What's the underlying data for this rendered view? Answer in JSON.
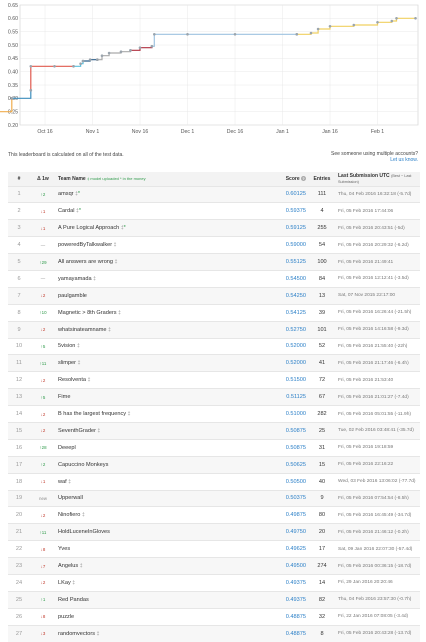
{
  "chart_data": {
    "type": "line",
    "x_tick_labels": [
      "Oct 16",
      "Nov 1",
      "Nov 16",
      "Dec 1",
      "Dec 16",
      "Jan 1",
      "Jan 16",
      "Feb 1"
    ],
    "y_tick_labels": [
      "0.20",
      "0.25",
      "0.30",
      "0.35",
      "0.40",
      "0.45",
      "0.50",
      "0.55",
      "0.60",
      "0.65"
    ],
    "ylim": [
      0.2,
      0.65
    ],
    "grid": true,
    "series": [
      {
        "color": "#f0ad4e",
        "points": [
          [
            -1.0,
            0.25
          ],
          [
            -0.7,
            0.3
          ]
        ]
      },
      {
        "color": "#3c8dbc",
        "points": [
          [
            -0.7,
            0.3
          ],
          [
            -0.3,
            0.33
          ]
        ]
      },
      {
        "color": "#e05a4f",
        "points": [
          [
            -0.3,
            0.33
          ],
          [
            -0.3,
            0.42
          ],
          [
            0.2,
            0.42
          ],
          [
            0.6,
            0.42
          ]
        ]
      },
      {
        "color": "#5bc0de",
        "points": [
          [
            0.6,
            0.42
          ],
          [
            0.75,
            0.43
          ],
          [
            0.8,
            0.44
          ]
        ]
      },
      {
        "color": "#2c5f8a",
        "points": [
          [
            0.8,
            0.44
          ],
          [
            0.95,
            0.445
          ],
          [
            1.1,
            0.445
          ]
        ]
      },
      {
        "color": "#aaaaaa",
        "points": [
          [
            1.1,
            0.445
          ],
          [
            1.2,
            0.46
          ],
          [
            1.35,
            0.47
          ],
          [
            1.6,
            0.475
          ],
          [
            1.8,
            0.48
          ]
        ]
      },
      {
        "color": "#b03040",
        "points": [
          [
            1.8,
            0.48
          ],
          [
            2.0,
            0.49
          ],
          [
            2.25,
            0.495
          ]
        ]
      },
      {
        "color": "#9fc3e0",
        "points": [
          [
            2.25,
            0.495
          ],
          [
            2.3,
            0.54
          ],
          [
            3.0,
            0.54
          ],
          [
            4.0,
            0.54
          ],
          [
            5.3,
            0.54
          ]
        ]
      },
      {
        "color": "#f0d060",
        "points": [
          [
            5.3,
            0.54
          ],
          [
            5.6,
            0.545
          ],
          [
            5.75,
            0.56
          ],
          [
            6.0,
            0.57
          ],
          [
            6.5,
            0.575
          ],
          [
            7.0,
            0.585
          ],
          [
            7.3,
            0.59
          ],
          [
            7.4,
            0.6
          ],
          [
            7.8,
            0.6
          ]
        ]
      }
    ]
  },
  "notes": {
    "left": "This leaderboard is calculated on all of the test data.",
    "right_line1": "See someone using multiple accounts?",
    "right_line2": "Let us know."
  },
  "table": {
    "headers": {
      "rank": "#",
      "delta": "Δ 1w",
      "team": "Team Name",
      "team_legend": "‡ model uploaded * in the money",
      "score": "Score",
      "entries": "Entries",
      "last": "Last Submission UTC",
      "last_sub": "(Best − Last Submission)"
    },
    "rows": [
      {
        "rank": "1",
        "delta": "↑2",
        "dir": "up",
        "team": "amsqr",
        "marks": "‡",
        "star": "*",
        "score": "0.60125",
        "entries": "111",
        "last": "Thu, 04 Feb 2016 16:32:18 (-5.7d)"
      },
      {
        "rank": "2",
        "delta": "↓1",
        "dir": "down",
        "team": "Cardal",
        "marks": "‡",
        "star": "*",
        "score": "0.59375",
        "entries": "4",
        "last": "Fri, 05 Feb 2016 17:44:06"
      },
      {
        "rank": "3",
        "delta": "↓1",
        "dir": "down",
        "team": "A Pure Logical Approach",
        "marks": "‡",
        "star": "*",
        "score": "0.59125",
        "entries": "255",
        "last": "Fri, 05 Feb 2016 20:43:51 (-5d)"
      },
      {
        "rank": "4",
        "delta": "—",
        "dir": "same",
        "team": "poweredByTalkwalker",
        "marks": "‡",
        "star": "",
        "score": "0.59000",
        "entries": "54",
        "last": "Fri, 05 Feb 2016 20:29:32 (-6.2d)"
      },
      {
        "rank": "5",
        "delta": "↑29",
        "dir": "up",
        "team": "All answers are wrong",
        "marks": "‡",
        "star": "",
        "score": "0.55125",
        "entries": "100",
        "last": "Fri, 05 Feb 2016 21:49:41"
      },
      {
        "rank": "6",
        "delta": "—",
        "dir": "same",
        "team": "yamayamada",
        "marks": "‡",
        "star": "",
        "score": "0.54500",
        "entries": "84",
        "last": "Fri, 05 Feb 2016 12:12:41 (-3.5d)"
      },
      {
        "rank": "7",
        "delta": "↓2",
        "dir": "down",
        "team": "paulgamble",
        "marks": "",
        "star": "",
        "score": "0.54250",
        "entries": "13",
        "last": "Sat, 07 Nov 2015 22:17:00"
      },
      {
        "rank": "8",
        "delta": "↑10",
        "dir": "up",
        "team": "Magnetic > 8th Graders",
        "marks": "‡",
        "star": "",
        "score": "0.54125",
        "entries": "39",
        "last": "Fri, 05 Feb 2016 16:26:44 (-21.5h)"
      },
      {
        "rank": "9",
        "delta": "↓2",
        "dir": "down",
        "team": "whatsinateamname",
        "marks": "‡",
        "star": "",
        "score": "0.52750",
        "entries": "101",
        "last": "Fri, 05 Feb 2016 14:16:58 (-9.3d)"
      },
      {
        "rank": "10",
        "delta": "↑5",
        "dir": "up",
        "team": "5vision",
        "marks": "‡",
        "star": "",
        "score": "0.52000",
        "entries": "52",
        "last": "Fri, 05 Feb 2016 21:55:40 (-22h)"
      },
      {
        "rank": "11",
        "delta": "↑11",
        "dir": "up",
        "team": "slimper",
        "marks": "‡",
        "star": "",
        "score": "0.52000",
        "entries": "41",
        "last": "Fri, 05 Feb 2016 21:17:46 (-6.4h)"
      },
      {
        "rank": "12",
        "delta": "↓2",
        "dir": "down",
        "team": "Resolventa",
        "marks": "‡",
        "star": "",
        "score": "0.51500",
        "entries": "72",
        "last": "Fri, 05 Feb 2016 21:53:40"
      },
      {
        "rank": "13",
        "delta": "↑5",
        "dir": "up",
        "team": "Fime",
        "marks": "",
        "star": "",
        "score": "0.51125",
        "entries": "67",
        "last": "Fri, 05 Feb 2016 21:01:27 (-7.4d)"
      },
      {
        "rank": "14",
        "delta": "↓2",
        "dir": "down",
        "team": "B has the largest frequency",
        "marks": "‡",
        "star": "",
        "score": "0.51000",
        "entries": "282",
        "last": "Fri, 05 Feb 2016 05:01:55 (-11.9h)"
      },
      {
        "rank": "15",
        "delta": "↓2",
        "dir": "down",
        "team": "SeventhGrader",
        "marks": "‡",
        "star": "",
        "score": "0.50875",
        "entries": "25",
        "last": "Tue, 02 Feb 2016 03:48:41 (-35.7d)"
      },
      {
        "rank": "16",
        "delta": "↑28",
        "dir": "up",
        "team": "Deeepl",
        "marks": "",
        "star": "",
        "score": "0.50875",
        "entries": "31",
        "last": "Fri, 05 Feb 2016 19:18:59"
      },
      {
        "rank": "17",
        "delta": "↑2",
        "dir": "up",
        "team": "Capuccino Monkeys",
        "marks": "",
        "star": "",
        "score": "0.50625",
        "entries": "15",
        "last": "Fri, 05 Feb 2016 22:16:22"
      },
      {
        "rank": "18",
        "delta": "↓1",
        "dir": "down",
        "team": "waf",
        "marks": "‡",
        "star": "",
        "score": "0.50500",
        "entries": "40",
        "last": "Wed, 03 Feb 2016 13:06:02 (-77.7d)"
      },
      {
        "rank": "19",
        "delta": "new",
        "dir": "new",
        "team": "Upperwall",
        "marks": "",
        "star": "",
        "score": "0.50375",
        "entries": "9",
        "last": "Fri, 05 Feb 2016 07:54:54 (-8.5h)"
      },
      {
        "rank": "20",
        "delta": "↓2",
        "dir": "down",
        "team": "Ninofiero",
        "marks": "‡",
        "star": "",
        "score": "0.49875",
        "entries": "80",
        "last": "Fri, 05 Feb 2016 16:45:49 (-34.7d)"
      },
      {
        "rank": "21",
        "delta": "↑11",
        "dir": "up",
        "team": "HoldLuceneInGloves",
        "marks": "",
        "star": "",
        "score": "0.49750",
        "entries": "20",
        "last": "Fri, 05 Feb 2016 21:46:12 (-0.2h)"
      },
      {
        "rank": "22",
        "delta": "↓8",
        "dir": "down",
        "team": "Yves",
        "marks": "",
        "star": "",
        "score": "0.49625",
        "entries": "17",
        "last": "Sat, 09 Jan 2016 22:07:30 (-57.4d)"
      },
      {
        "rank": "23",
        "delta": "↓7",
        "dir": "down",
        "team": "Angelus",
        "marks": "‡",
        "star": "",
        "score": "0.49500",
        "entries": "274",
        "last": "Fri, 05 Feb 2016 00:36:15 (-18.7d)"
      },
      {
        "rank": "24",
        "delta": "↓2",
        "dir": "down",
        "team": "LKay",
        "marks": "‡",
        "star": "",
        "score": "0.49375",
        "entries": "14",
        "last": "Fri, 29 Jan 2016 20:20:46"
      },
      {
        "rank": "25",
        "delta": "↑1",
        "dir": "up",
        "team": "Red Pandas",
        "marks": "",
        "star": "",
        "score": "0.49375",
        "entries": "82",
        "last": "Thu, 04 Feb 2016 23:57:30 (-0.7h)"
      },
      {
        "rank": "26",
        "delta": "↓8",
        "dir": "down",
        "team": "puzzle",
        "marks": "",
        "star": "",
        "score": "0.48875",
        "entries": "32",
        "last": "Fri, 22 Jan 2016 07:08:05 (-3.4d)"
      },
      {
        "rank": "27",
        "delta": "↓3",
        "dir": "down",
        "team": "randomvectors",
        "marks": "‡",
        "star": "",
        "score": "0.48875",
        "entries": "8",
        "last": "Fri, 05 Feb 2016 20:43:28 (-13.7d)"
      }
    ]
  }
}
